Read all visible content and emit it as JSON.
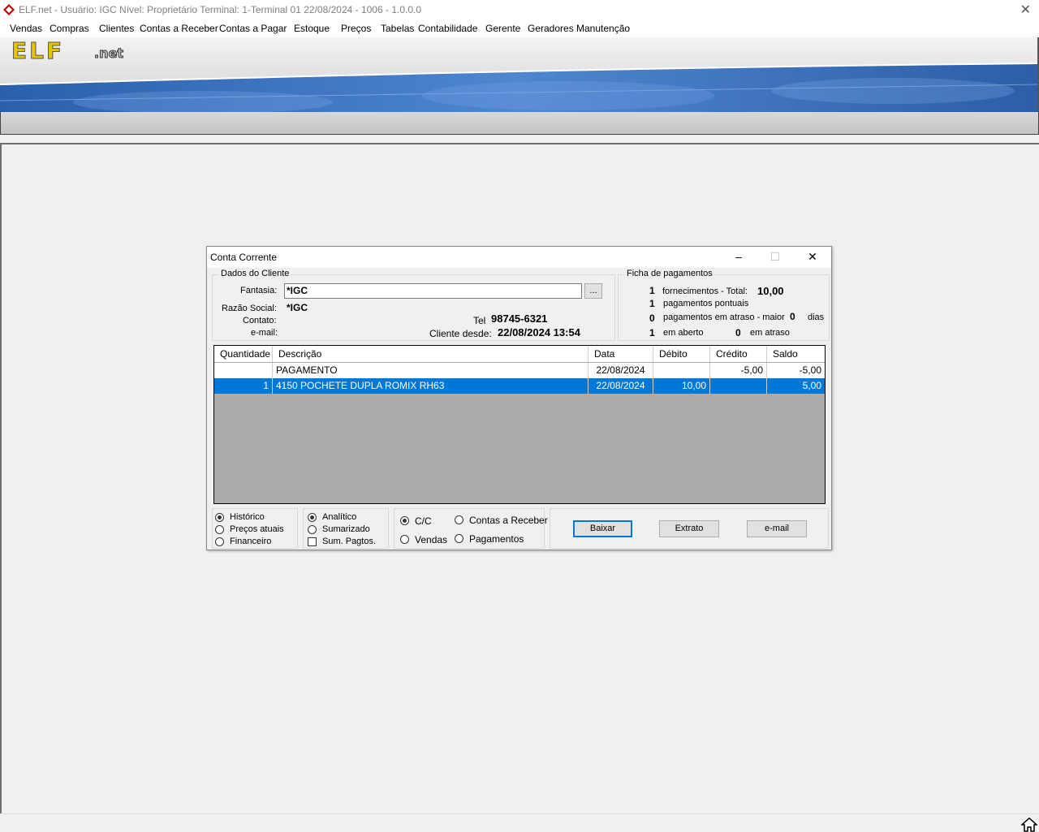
{
  "app": {
    "title": "ELF.net -   Usuário: IGC    Nível: Proprietário    Terminal: 1-Terminal 01    22/08/2024 - 1006 - 1.0.0.0",
    "logo_main": "ELF",
    "logo_sub": ".net"
  },
  "menu": [
    "Vendas",
    "Compras",
    "Clientes",
    "Contas a Receber",
    "Contas a Pagar",
    "Estoque",
    "Preços",
    "Tabelas",
    "Contabilidade",
    "Gerente",
    "Geradores",
    "Manutenção"
  ],
  "dialog": {
    "title": "Conta Corrente",
    "cliente": {
      "group_label": "Dados do Cliente",
      "fantasia_label": "Fantasia:",
      "fantasia_value": "*IGC",
      "ellipsis": "...",
      "razao_label": "Razão Social:",
      "razao_value": "*IGC",
      "contato_label": "Contato:",
      "email_label": "e-mail:",
      "tel_label": "Tel",
      "tel_value": "98745-6321",
      "desde_label": "Cliente desde:",
      "desde_value": "22/08/2024 13:54"
    },
    "ficha": {
      "group_label": "Ficha de pagamentos",
      "fornecimentos_count": "1",
      "fornecimentos_label": "fornecimentos - Total:",
      "total_value": "10,00",
      "pontuais_count": "1",
      "pontuais_label": "pagamentos pontuais",
      "atraso_count": "0",
      "atraso_label": "pagamentos em atraso - maior",
      "maior_value": "0",
      "dias_label": "dias",
      "aberto_count": "1",
      "aberto_label": "em aberto",
      "em_atraso_count": "0",
      "em_atraso_label": "em atraso"
    },
    "table": {
      "headers": [
        "Quantidade",
        "Descrição",
        "Data",
        "Débito",
        "Crédito",
        "Saldo"
      ],
      "rows": [
        {
          "qtd": "",
          "desc": "PAGAMENTO",
          "data": "22/08/2024",
          "debito": "",
          "credito": "-5,00",
          "saldo": "-5,00"
        },
        {
          "qtd": "1",
          "desc": "4150 POCHETE DUPLA ROMIX RH63",
          "data": "22/08/2024",
          "debito": "10,00",
          "credito": "",
          "saldo": "5,00"
        }
      ]
    },
    "options1": [
      "Histórico",
      "Preços atuais",
      "Financeiro"
    ],
    "options2": [
      "Analítico",
      "Sumarizado"
    ],
    "sum_pagtos": "Sum. Pagtos.",
    "options3": [
      "C/C",
      "Contas a Receber",
      "Vendas",
      "Pagamentos"
    ],
    "buttons": {
      "baixar": "Baixar",
      "extrato": "Extrato",
      "email": "e-mail"
    }
  }
}
